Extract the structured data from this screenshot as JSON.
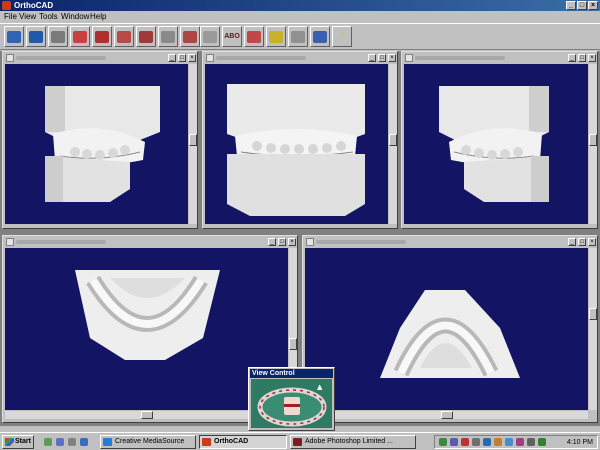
{
  "app": {
    "title": "OrthoCAD"
  },
  "menu": [
    "File",
    "View",
    "Tools",
    "Window",
    "Help"
  ],
  "toolbar": [
    {
      "name": "open-folder",
      "color": "#2f63b5"
    },
    {
      "name": "save",
      "color": "#1f5aa8"
    },
    {
      "name": "print",
      "color": "#7a7a7a"
    },
    {
      "name": "model-upper",
      "color": "#c94040"
    },
    {
      "name": "model-compare",
      "color": "#b03030"
    },
    {
      "name": "model-layout",
      "color": "#b84a4a"
    },
    {
      "name": "model-grid",
      "color": "#a03a3a"
    },
    {
      "name": "model-front",
      "color": "#8a8a8a"
    },
    {
      "name": "model-stack",
      "color": "#b04545"
    },
    {
      "name": "measure",
      "color": "#9a9a9a"
    },
    {
      "name": "abo-score",
      "label": "ABO",
      "color": "#6a0f0f"
    },
    {
      "name": "model-arch",
      "color": "#c14848"
    },
    {
      "name": "annotate",
      "color": "#c8b22a"
    },
    {
      "name": "ruler",
      "color": "#909090"
    },
    {
      "name": "arch-form",
      "color": "#3b5fb0"
    },
    {
      "name": "help",
      "label": "?",
      "color": "#d4c44a"
    }
  ],
  "view_control": {
    "title": "View Control"
  },
  "taskbar": {
    "start": "Start",
    "tasks": [
      "Creative MediaSource",
      "OrthoCAD",
      "Adobe Photoshop Limited ..."
    ],
    "clock": "4:10 PM"
  },
  "colors": {
    "titlebar": "#0a246a",
    "canvas": "#141464",
    "model": "#dcdcdc"
  }
}
